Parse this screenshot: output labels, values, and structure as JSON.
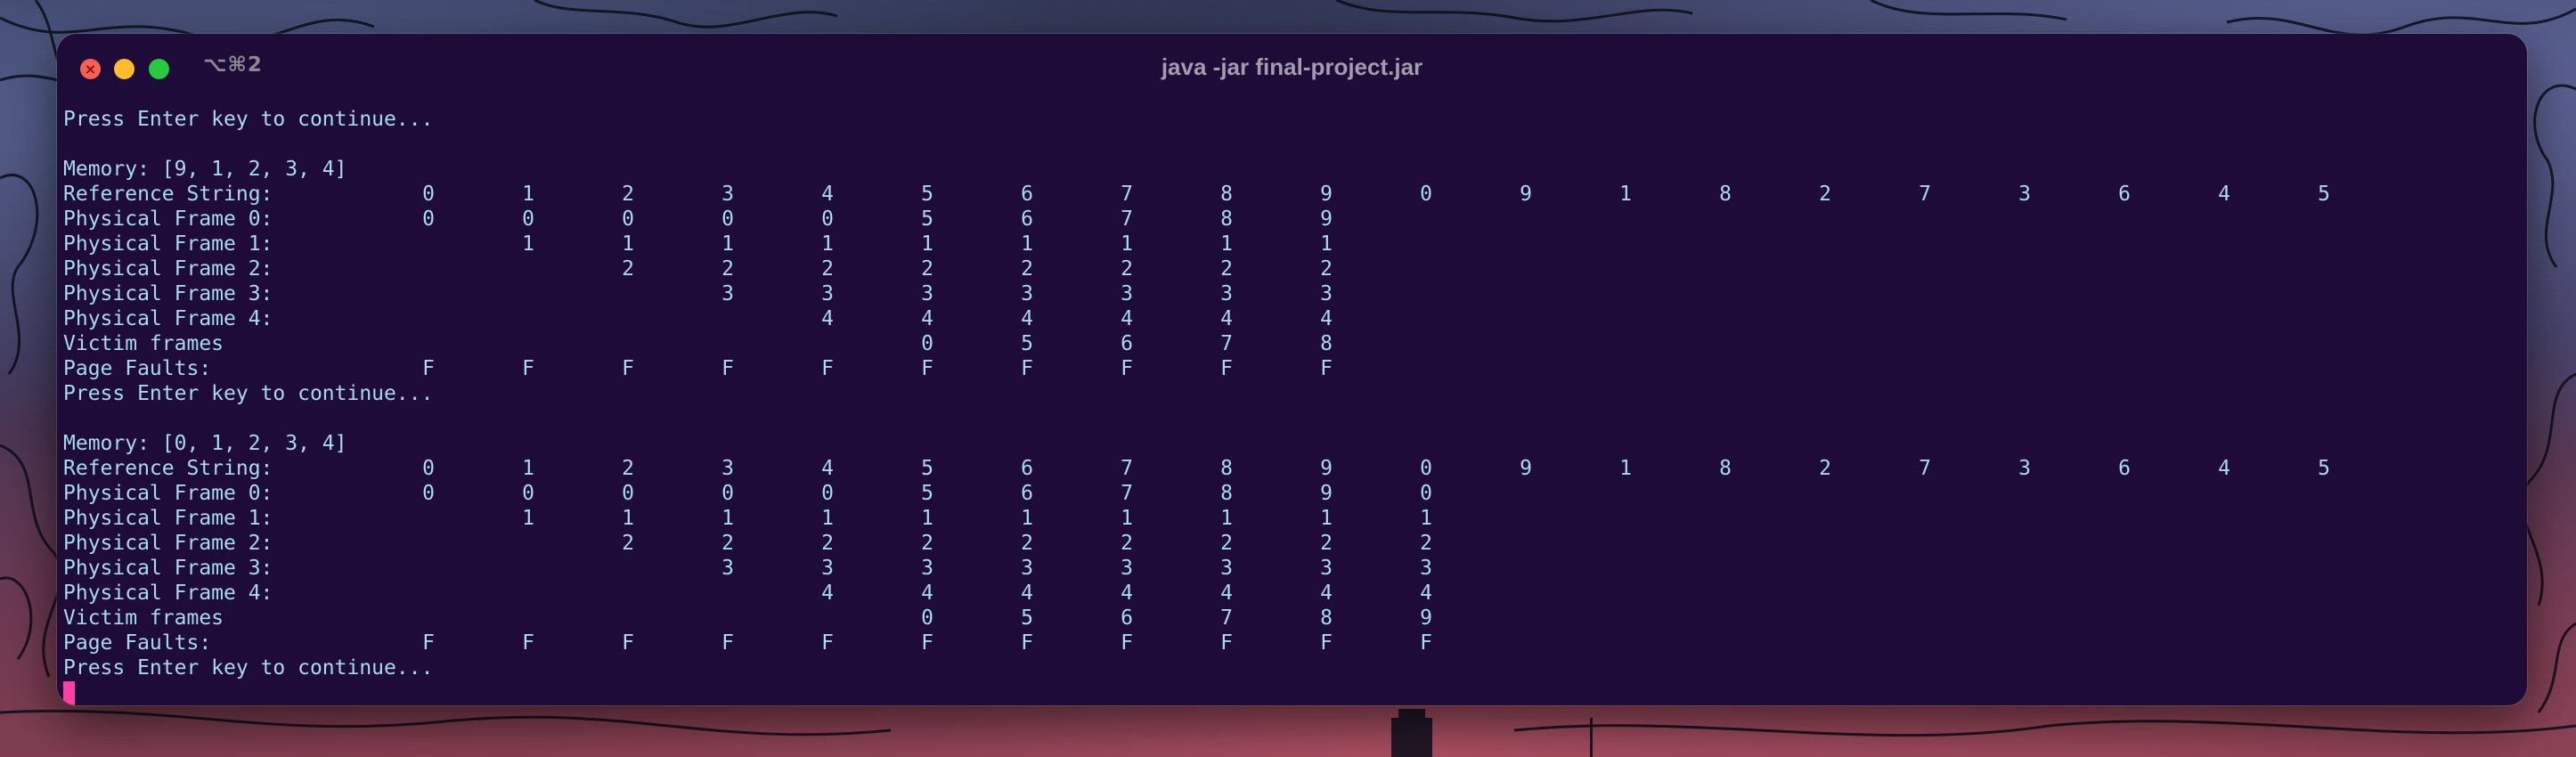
{
  "window": {
    "title": "java -jar final-project.jar",
    "shortcut": "⌥⌘2",
    "close_glyph": "×"
  },
  "terminal": {
    "blocks": [
      {
        "prompt_top": "Press Enter key to continue...",
        "memory": "Memory: [9, 1, 2, 3, 4]",
        "rows": [
          {
            "label": "Reference String:",
            "cells": [
              "0",
              "1",
              "2",
              "3",
              "4",
              "5",
              "6",
              "7",
              "8",
              "9",
              "0",
              "9",
              "1",
              "8",
              "2",
              "7",
              "3",
              "6",
              "4",
              "5"
            ]
          },
          {
            "label": "Physical Frame 0:",
            "cells": [
              "0",
              "0",
              "0",
              "0",
              "0",
              "5",
              "6",
              "7",
              "8",
              "9",
              "",
              "",
              "",
              "",
              "",
              "",
              "",
              "",
              "",
              ""
            ]
          },
          {
            "label": "Physical Frame 1:",
            "cells": [
              "",
              "1",
              "1",
              "1",
              "1",
              "1",
              "1",
              "1",
              "1",
              "1",
              "",
              "",
              "",
              "",
              "",
              "",
              "",
              "",
              "",
              ""
            ]
          },
          {
            "label": "Physical Frame 2:",
            "cells": [
              "",
              "",
              "2",
              "2",
              "2",
              "2",
              "2",
              "2",
              "2",
              "2",
              "",
              "",
              "",
              "",
              "",
              "",
              "",
              "",
              "",
              ""
            ]
          },
          {
            "label": "Physical Frame 3:",
            "cells": [
              "",
              "",
              "",
              "3",
              "3",
              "3",
              "3",
              "3",
              "3",
              "3",
              "",
              "",
              "",
              "",
              "",
              "",
              "",
              "",
              "",
              ""
            ]
          },
          {
            "label": "Physical Frame 4:",
            "cells": [
              "",
              "",
              "",
              "",
              "4",
              "4",
              "4",
              "4",
              "4",
              "4",
              "",
              "",
              "",
              "",
              "",
              "",
              "",
              "",
              "",
              ""
            ]
          },
          {
            "label": "Victim frames",
            "cells": [
              "",
              "",
              "",
              "",
              "",
              "0",
              "5",
              "6",
              "7",
              "8",
              "",
              "",
              "",
              "",
              "",
              "",
              "",
              "",
              "",
              ""
            ]
          },
          {
            "label": "Page Faults:",
            "cells": [
              "F",
              "F",
              "F",
              "F",
              "F",
              "F",
              "F",
              "F",
              "F",
              "F",
              "",
              "",
              "",
              "",
              "",
              "",
              "",
              "",
              "",
              ""
            ]
          }
        ],
        "prompt_bottom": "Press Enter key to continue..."
      },
      {
        "memory": "Memory: [0, 1, 2, 3, 4]",
        "rows": [
          {
            "label": "Reference String:",
            "cells": [
              "0",
              "1",
              "2",
              "3",
              "4",
              "5",
              "6",
              "7",
              "8",
              "9",
              "0",
              "9",
              "1",
              "8",
              "2",
              "7",
              "3",
              "6",
              "4",
              "5"
            ]
          },
          {
            "label": "Physical Frame 0:",
            "cells": [
              "0",
              "0",
              "0",
              "0",
              "0",
              "5",
              "6",
              "7",
              "8",
              "9",
              "0",
              "",
              "",
              "",
              "",
              "",
              "",
              "",
              "",
              ""
            ]
          },
          {
            "label": "Physical Frame 1:",
            "cells": [
              "",
              "1",
              "1",
              "1",
              "1",
              "1",
              "1",
              "1",
              "1",
              "1",
              "1",
              "",
              "",
              "",
              "",
              "",
              "",
              "",
              "",
              ""
            ]
          },
          {
            "label": "Physical Frame 2:",
            "cells": [
              "",
              "",
              "2",
              "2",
              "2",
              "2",
              "2",
              "2",
              "2",
              "2",
              "2",
              "",
              "",
              "",
              "",
              "",
              "",
              "",
              "",
              ""
            ]
          },
          {
            "label": "Physical Frame 3:",
            "cells": [
              "",
              "",
              "",
              "3",
              "3",
              "3",
              "3",
              "3",
              "3",
              "3",
              "3",
              "",
              "",
              "",
              "",
              "",
              "",
              "",
              "",
              ""
            ]
          },
          {
            "label": "Physical Frame 4:",
            "cells": [
              "",
              "",
              "",
              "",
              "4",
              "4",
              "4",
              "4",
              "4",
              "4",
              "4",
              "",
              "",
              "",
              "",
              "",
              "",
              "",
              "",
              ""
            ]
          },
          {
            "label": "Victim frames",
            "cells": [
              "",
              "",
              "",
              "",
              "",
              "0",
              "5",
              "6",
              "7",
              "8",
              "9",
              "",
              "",
              "",
              "",
              "",
              "",
              "",
              "",
              ""
            ]
          },
          {
            "label": "Page Faults:",
            "cells": [
              "F",
              "F",
              "F",
              "F",
              "F",
              "F",
              "F",
              "F",
              "F",
              "F",
              "F",
              "",
              "",
              "",
              "",
              "",
              "",
              "",
              "",
              ""
            ]
          }
        ],
        "prompt_bottom": "Press Enter key to continue..."
      }
    ]
  },
  "colors": {
    "terminal_background": "#1e0b38",
    "terminal_text": "#a8d8f2",
    "cursor": "#ff3fa4"
  }
}
